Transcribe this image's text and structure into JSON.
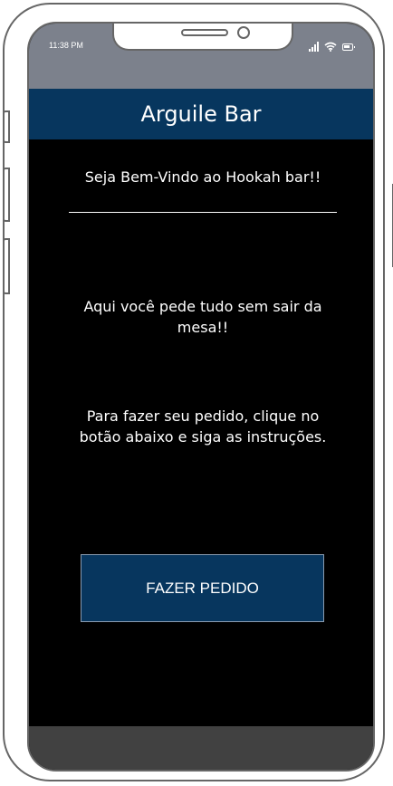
{
  "status_bar": {
    "time": "11:38 PM",
    "icons": [
      "signal-icon",
      "wifi-icon",
      "battery-icon"
    ]
  },
  "header": {
    "title": "Arguile Bar"
  },
  "main": {
    "welcome": "Seja Bem-Vindo ao Hookah bar!!",
    "tagline": "Aqui você pede tudo sem sair da mesa!!",
    "instructions": "Para fazer seu pedido, clique no botão abaixo e siga as instruções.",
    "order_button_label": "FAZER PEDIDO"
  },
  "colors": {
    "header_bg": "#07365e",
    "button_bg": "#07365e",
    "screen_bg": "#000000",
    "status_bar_bg": "#7c818c",
    "bottom_bar_bg": "#414141"
  }
}
